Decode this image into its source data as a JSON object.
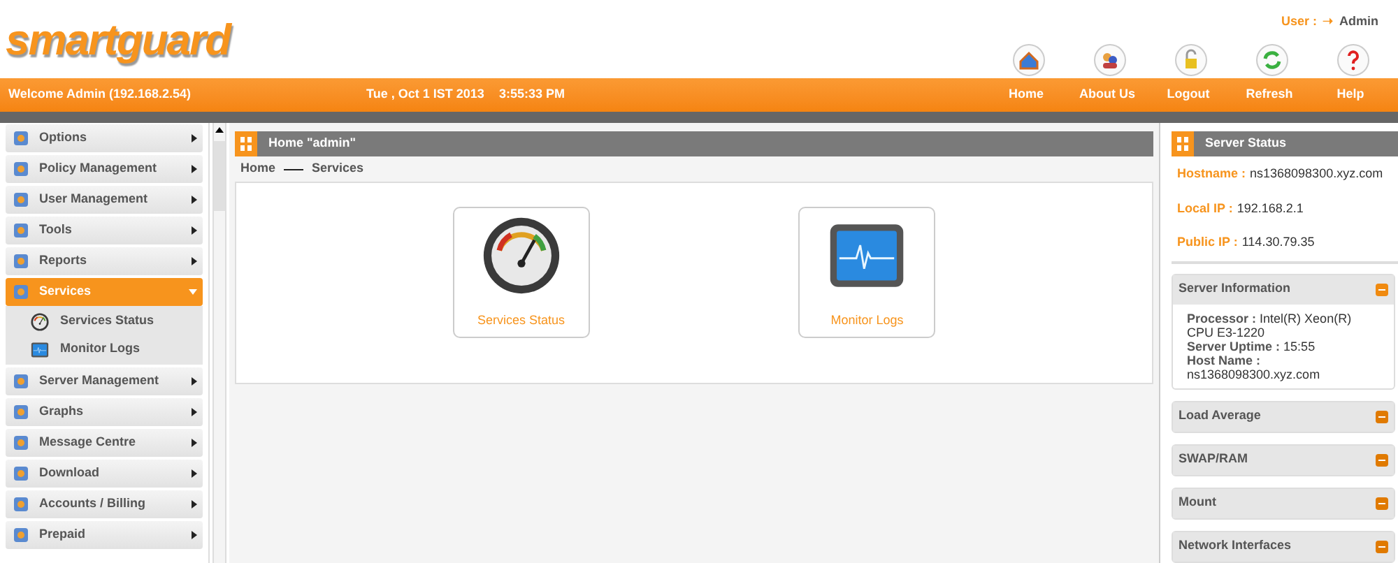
{
  "header": {
    "logo": "smartguard",
    "user_label": "User :",
    "user_arrow": "➝",
    "user_name": "Admin",
    "nav": [
      {
        "label": "Home",
        "kind": "home"
      },
      {
        "label": "About Us",
        "kind": "people"
      },
      {
        "label": "Logout",
        "kind": "lock"
      },
      {
        "label": "Refresh",
        "kind": "refresh"
      },
      {
        "label": "Help",
        "kind": "help"
      }
    ],
    "welcome": "Welcome Admin (192.168.2.54)",
    "date": "Tue , Oct 1 IST 2013",
    "time": "3:55:33 PM"
  },
  "sidebar": {
    "items": [
      {
        "label": "Options",
        "selected": false,
        "expanded": false
      },
      {
        "label": "Policy Management",
        "selected": false,
        "expanded": false
      },
      {
        "label": "User Management",
        "selected": false,
        "expanded": false
      },
      {
        "label": "Tools",
        "selected": false,
        "expanded": false
      },
      {
        "label": "Reports",
        "selected": false,
        "expanded": false
      },
      {
        "label": "Services",
        "selected": true,
        "expanded": true,
        "children": [
          {
            "label": "Services Status",
            "kind": "gauge"
          },
          {
            "label": "Monitor Logs",
            "kind": "monitor"
          }
        ]
      },
      {
        "label": "Server Management",
        "selected": false,
        "expanded": false
      },
      {
        "label": "Graphs",
        "selected": false,
        "expanded": false
      },
      {
        "label": "Message Centre",
        "selected": false,
        "expanded": false
      },
      {
        "label": "Download",
        "selected": false,
        "expanded": false
      },
      {
        "label": "Accounts / Billing",
        "selected": false,
        "expanded": false
      },
      {
        "label": "Prepaid",
        "selected": false,
        "expanded": false
      }
    ]
  },
  "main": {
    "title": "Home \"admin\"",
    "breadcrumb": [
      "Home",
      "Services"
    ],
    "tiles": [
      {
        "label": "Services Status",
        "kind": "gauge"
      },
      {
        "label": "Monitor Logs",
        "kind": "monitor"
      }
    ]
  },
  "server_status": {
    "title": "Server Status",
    "facts": [
      {
        "label": "Hostname :",
        "value": "ns1368098300.xyz.com"
      },
      {
        "label": "Local IP :",
        "value": "192.168.2.1"
      },
      {
        "label": "Public IP :",
        "value": "114.30.79.35"
      }
    ],
    "sections": [
      {
        "title": "Server Information",
        "expanded": true,
        "details": [
          {
            "label": "Processor :",
            "value": "Intel(R) Xeon(R) CPU E3-1220"
          },
          {
            "label": "Server Uptime :",
            "value": "15:55"
          },
          {
            "label": "Host Name :",
            "value": "ns1368098300.xyz.com"
          }
        ]
      },
      {
        "title": "Load Average",
        "expanded": false
      },
      {
        "title": "SWAP/RAM",
        "expanded": false
      },
      {
        "title": "Mount",
        "expanded": false
      },
      {
        "title": "Network Interfaces",
        "expanded": false
      }
    ]
  }
}
